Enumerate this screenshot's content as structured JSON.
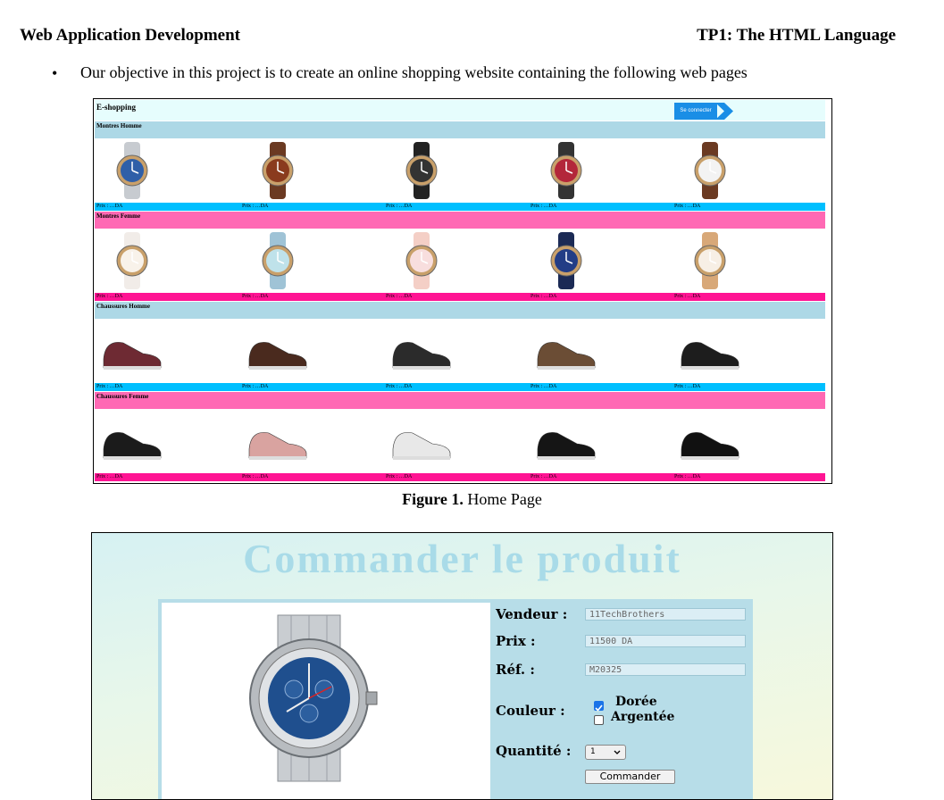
{
  "doc": {
    "header_left": "Web Application Development",
    "header_right": "TP1: The HTML Language",
    "bullet": "Our objective in this project is to create an online shopping website containing the following web pages"
  },
  "home": {
    "brand": "E-shopping",
    "connect_label": "Se connecter",
    "price_label": "Prix : …DA",
    "sections": [
      {
        "title": "Montres Homme",
        "cat_color": "#add8e6",
        "price_color": "#00bfff",
        "items": [
          "man-watch-silver-blue",
          "man-watch-brown-leather",
          "man-watch-black-digital",
          "man-watch-red-dial",
          "man-watch-white-chrono"
        ]
      },
      {
        "title": "Montres Femme",
        "cat_color": "#ff69b4",
        "price_color": "#ff1493",
        "items": [
          "woman-watch-white-strap",
          "woman-watch-light-blue",
          "woman-watch-pink",
          "woman-watch-navy-gold",
          "woman-watch-gold-bracelet"
        ]
      },
      {
        "title": "Chaussures Homme",
        "cat_color": "#add8e6",
        "price_color": "#00bfff",
        "items": [
          "man-shoe-burgundy-sneaker",
          "man-shoe-brown-derby",
          "man-shoe-black-hiker",
          "man-shoe-brown-boot",
          "man-shoe-black-runner"
        ]
      },
      {
        "title": "Chaussures Femme",
        "cat_color": "#ff69b4",
        "price_color": "#ff1493",
        "items": [
          "woman-shoe-black-boot",
          "woman-shoe-pink-sneaker",
          "woman-shoe-white-sneaker",
          "woman-shoe-black-combat",
          "woman-shoe-black-loafer"
        ]
      }
    ]
  },
  "figure1_caption": {
    "label": "Figure 1.",
    "text": "Home Page"
  },
  "order": {
    "title": "Commander le produit",
    "vendeur_label": "Vendeur :",
    "vendeur_value": "11TechBrothers",
    "prix_label": "Prix :",
    "prix_value": "11500 DA",
    "ref_label": "Réf. :",
    "ref_value": "M20325",
    "couleur_label": "Couleur :",
    "color_options": [
      {
        "label": "Dorée",
        "checked": true
      },
      {
        "label": "Argentée",
        "checked": false
      }
    ],
    "quantite_label": "Quantité :",
    "quantite_value": "1",
    "submit_label": "Commander"
  }
}
